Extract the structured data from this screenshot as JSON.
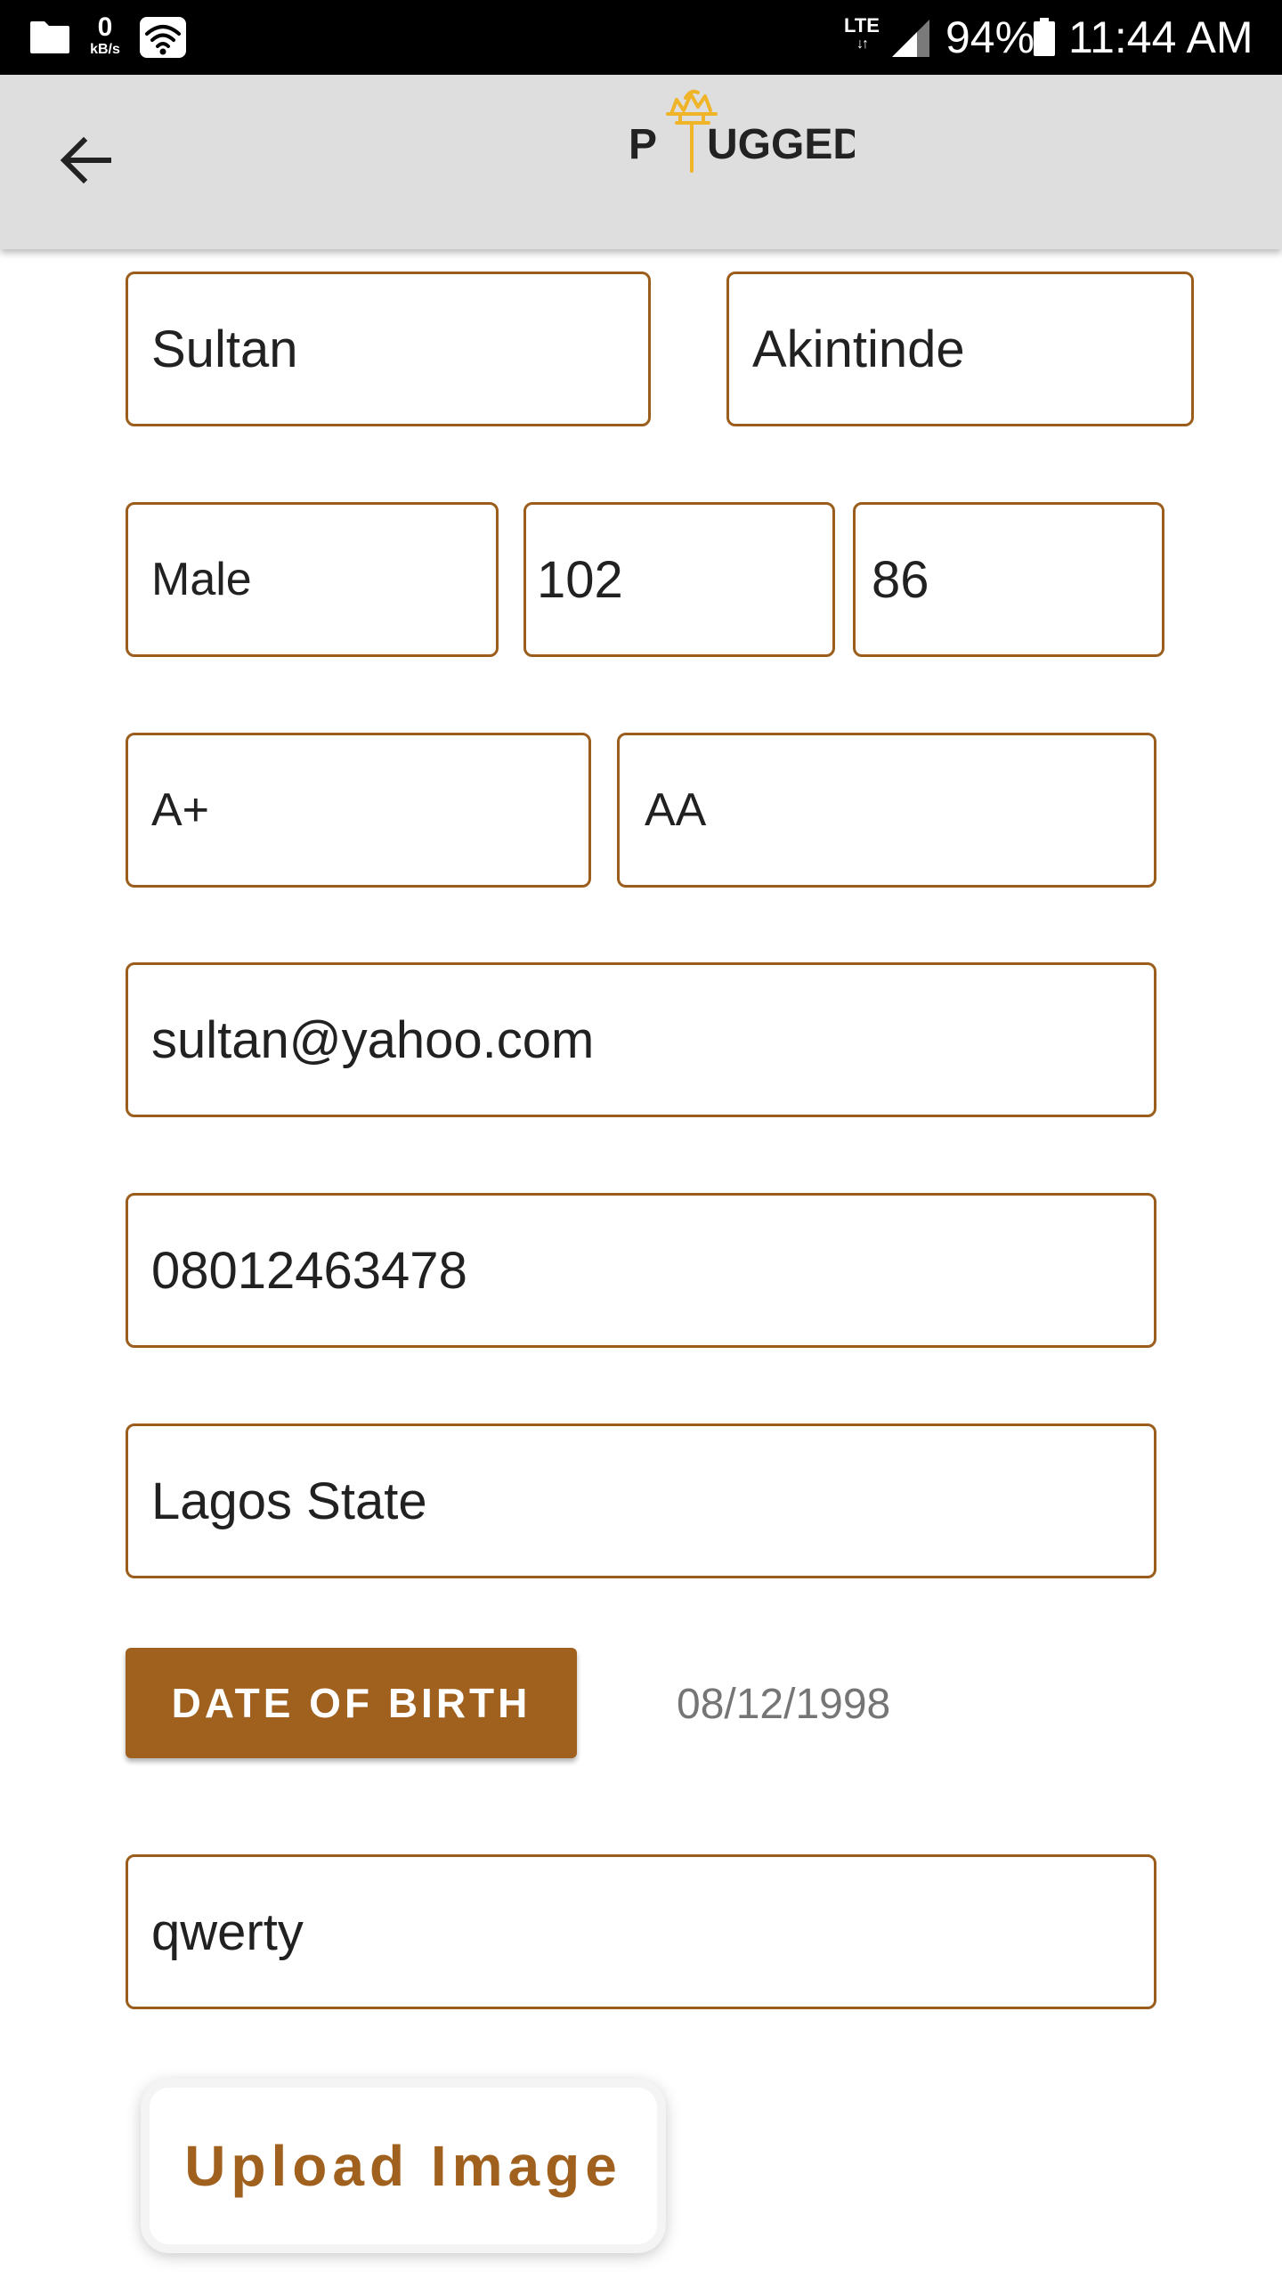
{
  "status_bar": {
    "net_speed_value": "0",
    "net_speed_unit": "kB/s",
    "network_type": "LTE",
    "network_arrows": "↓↑",
    "battery_percent": "94%",
    "time": "11:44 AM"
  },
  "app_bar": {
    "logo_text": "PLUGGED",
    "back_icon": "arrow-left-icon"
  },
  "form": {
    "first_name": "Sultan",
    "last_name": "Akintinde",
    "gender": "Male",
    "height": "102",
    "weight": "86",
    "blood_group": "A+",
    "genotype": "AA",
    "email": "sultan@yahoo.com",
    "phone": "08012463478",
    "state": "Lagos State",
    "dob_button_label": "DATE OF BIRTH",
    "dob_value": "08/12/1998",
    "password": "qwerty",
    "upload_label": "Upload Image"
  },
  "colors": {
    "accent": "#a0601e",
    "field_border": "#9b5d1c",
    "app_bar_bg": "#dedede",
    "logo_yellow": "#f0b429"
  }
}
